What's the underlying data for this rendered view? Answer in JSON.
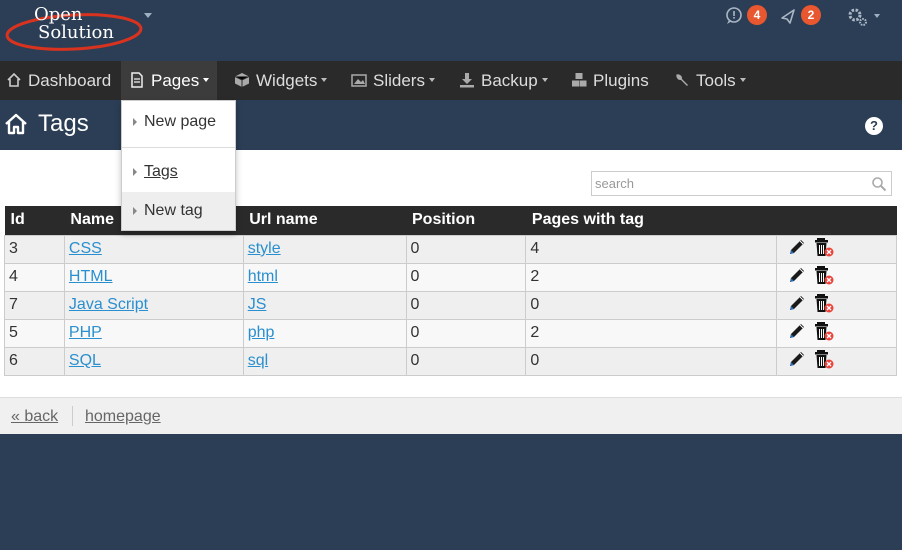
{
  "logo": {
    "line1": "Open",
    "line2": "Solution"
  },
  "top": {
    "messages_count": "4",
    "notifications_count": "2"
  },
  "nav": {
    "items": [
      {
        "label": "Dashboard"
      },
      {
        "label": "Pages"
      },
      {
        "label": "Widgets"
      },
      {
        "label": "Sliders"
      },
      {
        "label": "Backup"
      },
      {
        "label": "Plugins"
      },
      {
        "label": "Tools"
      }
    ]
  },
  "page": {
    "title": "Tags",
    "help": "?"
  },
  "dropdown": {
    "items": [
      "New page",
      "Tags",
      "New tag"
    ]
  },
  "search": {
    "placeholder": "search"
  },
  "table": {
    "headers": [
      "Id",
      "Name",
      "Url name",
      "Position",
      "Pages with tag"
    ],
    "rows": [
      {
        "id": "3",
        "name": "CSS",
        "url": "style",
        "position": "0",
        "pages": "4"
      },
      {
        "id": "4",
        "name": "HTML",
        "url": "html",
        "position": "0",
        "pages": "2"
      },
      {
        "id": "7",
        "name": "Java Script",
        "url": "JS",
        "position": "0",
        "pages": "0"
      },
      {
        "id": "5",
        "name": "PHP",
        "url": "php",
        "position": "0",
        "pages": "2"
      },
      {
        "id": "6",
        "name": "SQL",
        "url": "sql",
        "position": "0",
        "pages": "0"
      }
    ]
  },
  "footer": {
    "back": "« back",
    "homepage": "homepage"
  },
  "colors": {
    "header_bg": "#2b3e55",
    "nav_bg": "#2a2a2a",
    "badge": "#e8572f",
    "link": "#2a8fcf"
  }
}
